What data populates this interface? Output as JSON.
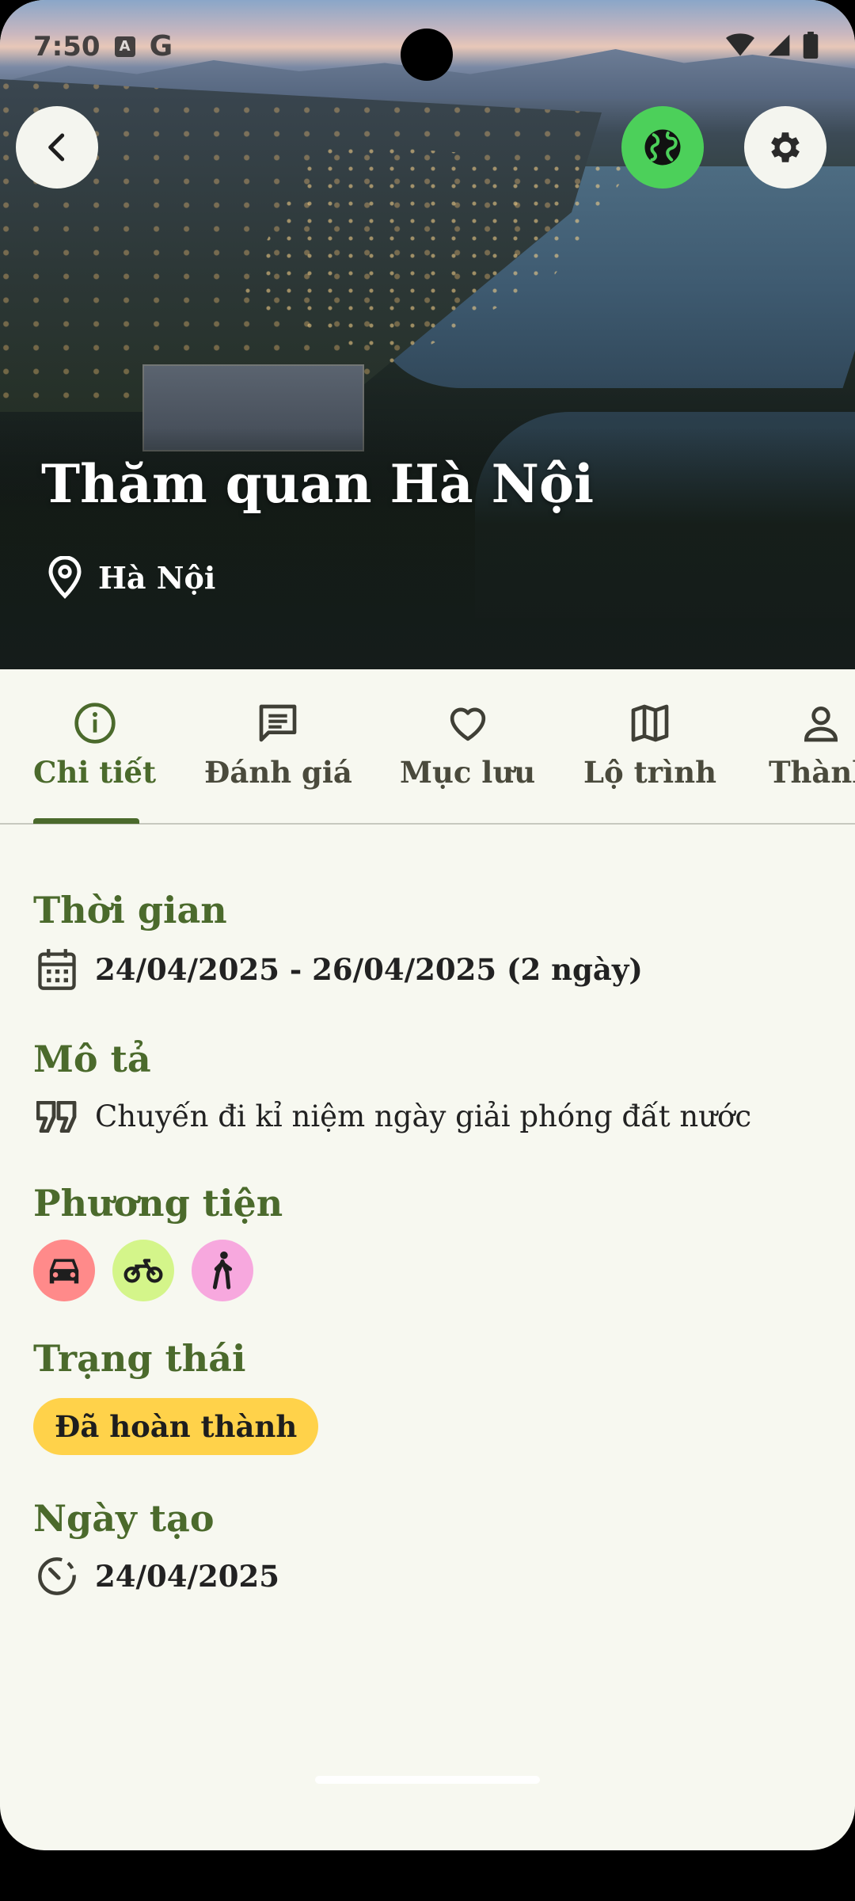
{
  "status_bar": {
    "time": "7:50"
  },
  "hero": {
    "title": "Thăm quan Hà Nội",
    "location": "Hà Nội"
  },
  "tabs": [
    {
      "label": "Chi tiết",
      "icon": "info-icon",
      "active": true
    },
    {
      "label": "Đánh giá",
      "icon": "comment-icon"
    },
    {
      "label": "Mục lưu",
      "icon": "heart-icon"
    },
    {
      "label": "Lộ trình",
      "icon": "map-icon"
    },
    {
      "label": "Thành",
      "icon": "person-icon"
    }
  ],
  "details": {
    "time": {
      "title": "Thời gian",
      "value": "24/04/2025 - 26/04/2025 (2 ngày)"
    },
    "description": {
      "title": "Mô tả",
      "value": "Chuyến đi kỉ niệm ngày giải phóng đất nước"
    },
    "vehicles": {
      "title": "Phương tiện",
      "items": [
        {
          "icon": "car-icon",
          "color": "#ff8a8a"
        },
        {
          "icon": "motorbike-icon",
          "color": "#d4f58a"
        },
        {
          "icon": "walk-icon",
          "color": "#f7a8de"
        }
      ]
    },
    "status": {
      "title": "Trạng thái",
      "value": "Đã hoàn thành",
      "color": "#ffd24a"
    },
    "created": {
      "title": "Ngày tạo",
      "value": "24/04/2025"
    }
  },
  "colors": {
    "accent": "#4b6a2c",
    "background": "#f7f8f0",
    "globe_button": "#4cd05a"
  }
}
